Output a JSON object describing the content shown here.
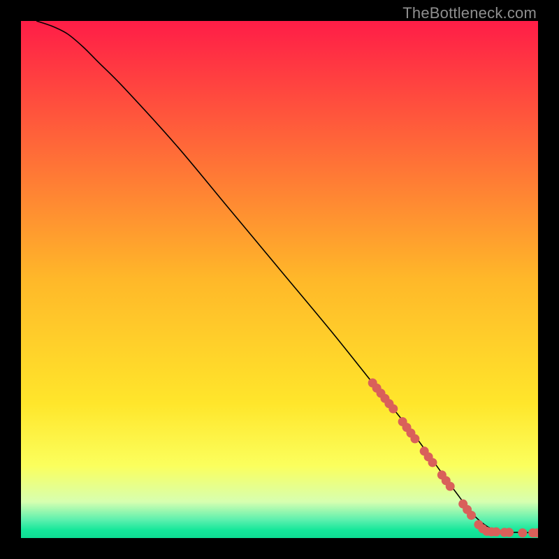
{
  "watermark": "TheBottleneck.com",
  "chart_data": {
    "type": "line",
    "title": "",
    "xlabel": "",
    "ylabel": "",
    "xlim": [
      0,
      100
    ],
    "ylim": [
      0,
      100
    ],
    "grid": false,
    "legend": false,
    "background_gradient": {
      "stops": [
        {
          "offset": 0.0,
          "color": "#ff1d47"
        },
        {
          "offset": 0.5,
          "color": "#ffb829"
        },
        {
          "offset": 0.74,
          "color": "#ffe62b"
        },
        {
          "offset": 0.86,
          "color": "#fbff5d"
        },
        {
          "offset": 0.93,
          "color": "#d7ffb0"
        },
        {
          "offset": 0.965,
          "color": "#5cf0ae"
        },
        {
          "offset": 0.985,
          "color": "#14e79a"
        },
        {
          "offset": 1.0,
          "color": "#0edc93"
        }
      ]
    },
    "series": [
      {
        "name": "curve",
        "x": [
          3,
          6,
          9,
          12,
          15,
          20,
          30,
          40,
          50,
          60,
          68,
          72,
          76,
          80,
          84,
          88,
          92,
          96,
          100
        ],
        "y": [
          100,
          99,
          97.5,
          95,
          92,
          87,
          76,
          64,
          52,
          40,
          30,
          25,
          20,
          14.5,
          9,
          4,
          1.3,
          1.1,
          1.0
        ],
        "stroke": "#000000",
        "stroke_width": 1.6
      }
    ],
    "scatter": [
      {
        "name": "markers",
        "color": "#d9605a",
        "radius": 6.5,
        "points": [
          {
            "x": 68.0,
            "y": 30.0
          },
          {
            "x": 68.8,
            "y": 29.0
          },
          {
            "x": 69.6,
            "y": 28.0
          },
          {
            "x": 70.4,
            "y": 27.0
          },
          {
            "x": 71.2,
            "y": 26.0
          },
          {
            "x": 72.0,
            "y": 25.0
          },
          {
            "x": 73.8,
            "y": 22.5
          },
          {
            "x": 74.6,
            "y": 21.4
          },
          {
            "x": 75.4,
            "y": 20.3
          },
          {
            "x": 76.2,
            "y": 19.2
          },
          {
            "x": 78.0,
            "y": 16.8
          },
          {
            "x": 78.8,
            "y": 15.7
          },
          {
            "x": 79.6,
            "y": 14.6
          },
          {
            "x": 81.4,
            "y": 12.2
          },
          {
            "x": 82.2,
            "y": 11.1
          },
          {
            "x": 83.0,
            "y": 10.0
          },
          {
            "x": 85.5,
            "y": 6.6
          },
          {
            "x": 86.3,
            "y": 5.5
          },
          {
            "x": 87.1,
            "y": 4.4
          },
          {
            "x": 88.5,
            "y": 2.6
          },
          {
            "x": 89.3,
            "y": 1.8
          },
          {
            "x": 90.1,
            "y": 1.3
          },
          {
            "x": 91.0,
            "y": 1.2
          },
          {
            "x": 91.9,
            "y": 1.2
          },
          {
            "x": 93.5,
            "y": 1.1
          },
          {
            "x": 94.4,
            "y": 1.1
          },
          {
            "x": 97.0,
            "y": 1.0
          },
          {
            "x": 99.0,
            "y": 1.0
          },
          {
            "x": 99.8,
            "y": 1.0
          }
        ]
      }
    ]
  }
}
